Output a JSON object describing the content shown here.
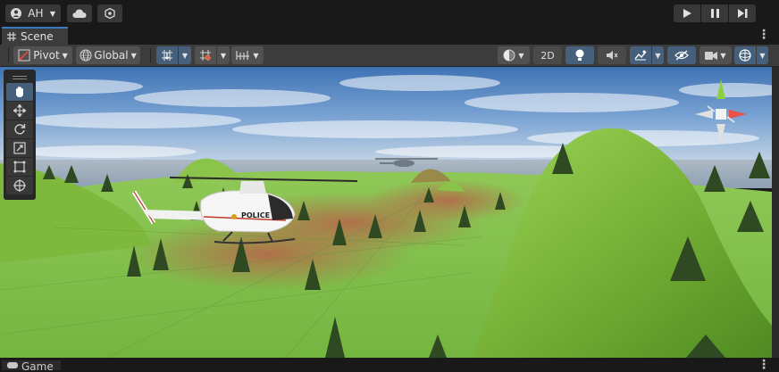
{
  "toolbar": {
    "account_label": "AH"
  },
  "scene_tab": {
    "label": "Scene"
  },
  "scene_toolbar": {
    "pivot_label": "Pivot",
    "global_label": "Global",
    "mode_2d_label": "2D"
  },
  "game_tab": {
    "label": "Game"
  },
  "scene": {
    "helicopter_decal": "POLICE"
  },
  "colors": {
    "accent": "#3a79bb",
    "active_button": "#46607c",
    "panel": "#3c3c3c",
    "background": "#191919"
  },
  "icons": [
    "account-icon",
    "cloud-icon",
    "collab-icon",
    "play-icon",
    "pause-icon",
    "step-icon",
    "hash-icon",
    "pivot-icon",
    "global-icon",
    "snap-icon",
    "grid-icon",
    "increment-icon",
    "shading-icon",
    "light-icon",
    "audio-icon",
    "effects-icon",
    "visibility-icon",
    "camera-icon",
    "gizmos-icon",
    "hand-tool-icon",
    "move-tool-icon",
    "rotate-tool-icon",
    "scale-tool-icon",
    "rect-tool-icon",
    "transform-tool-icon"
  ]
}
